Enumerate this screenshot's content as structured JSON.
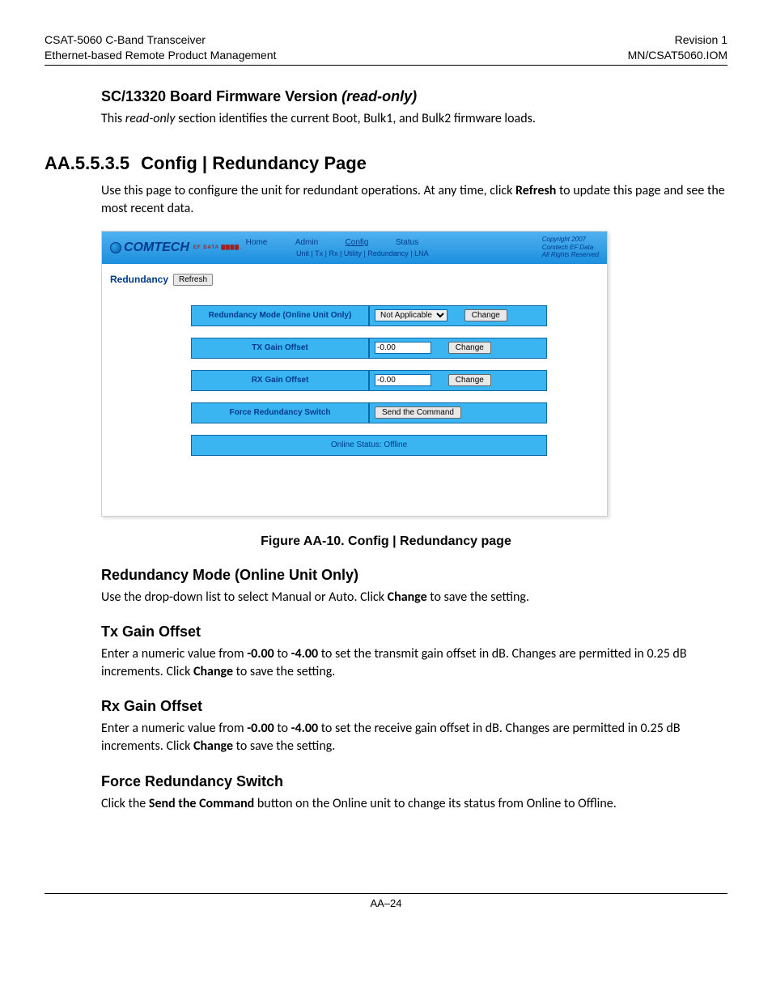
{
  "header": {
    "left": "CSAT-5060 C-Band Transceiver\nEthernet-based Remote Product Management",
    "right": "Revision 1\nMN/CSAT5060.IOM"
  },
  "sec1": {
    "title_plain": "SC/13320 Board Firmware Version ",
    "title_em": "(read-only)",
    "p_a": "This ",
    "p_em": "read-only",
    "p_b": " section identifies the current Boot, Bulk1, and Bulk2 firmware loads."
  },
  "sec2": {
    "num": "AA.5.5.3.5",
    "title": "Config | Redundancy Page",
    "p_a": "Use this page to configure the unit for redundant operations. At any time, click ",
    "p_b": "Refresh",
    "p_c": " to update this page and see the most recent data."
  },
  "fig": {
    "logo": "COMTECH",
    "logo_sub": "EF DATA ▇▇▇▇.",
    "nav": {
      "home": "Home",
      "admin": "Admin",
      "config": "Config",
      "status": "Status"
    },
    "subnav": "Unit | Tx | Rx | Utility | Redundancy | LNA",
    "copy": "Copyright 2007\nComtech EF Data\nAll Rights Reserved",
    "side_label": "Redundancy",
    "refresh": "Refresh",
    "rows": {
      "r1_label": "Redundancy Mode (Online Unit Only)",
      "r1_opt": "Not Applicable",
      "r1_btn": "Change",
      "r2_label": "TX Gain Offset",
      "r2_val": "-0.00",
      "r2_btn": "Change",
      "r3_label": "RX Gain Offset",
      "r3_val": "-0.00",
      "r3_btn": "Change",
      "r4_label": "Force Redundancy Switch",
      "r4_btn": "Send the Command",
      "r5_label": "Online Status: Offline"
    },
    "caption": "Figure AA-10. Config | Redundancy page"
  },
  "sec3": {
    "h": "Redundancy Mode (Online Unit Only)",
    "p_a": "Use the drop-down list to select Manual or Auto. Click ",
    "p_b": "Change",
    "p_c": " to save the setting."
  },
  "sec4": {
    "h": "Tx Gain Offset",
    "p_a": "Enter a numeric value from ",
    "p_b": "-0.00",
    "p_c": " to ",
    "p_d": "-4.00",
    "p_e": " to set the transmit gain offset in dB. Changes are permitted in 0.25 dB increments. Click ",
    "p_f": "Change",
    "p_g": " to save the setting."
  },
  "sec5": {
    "h": "Rx Gain Offset",
    "p_a": "Enter a numeric value from ",
    "p_b": "-0.00",
    "p_c": " to ",
    "p_d": "-4.00",
    "p_e": " to set the receive gain offset in dB. Changes are permitted in 0.25 dB increments. Click ",
    "p_f": "Change",
    "p_g": " to save the setting."
  },
  "sec6": {
    "h": "Force Redundancy Switch",
    "p_a": "Click the ",
    "p_b": "Send the Command",
    "p_c": " button on the Online unit to change its status from Online to Offline."
  },
  "footer": "AA–24"
}
